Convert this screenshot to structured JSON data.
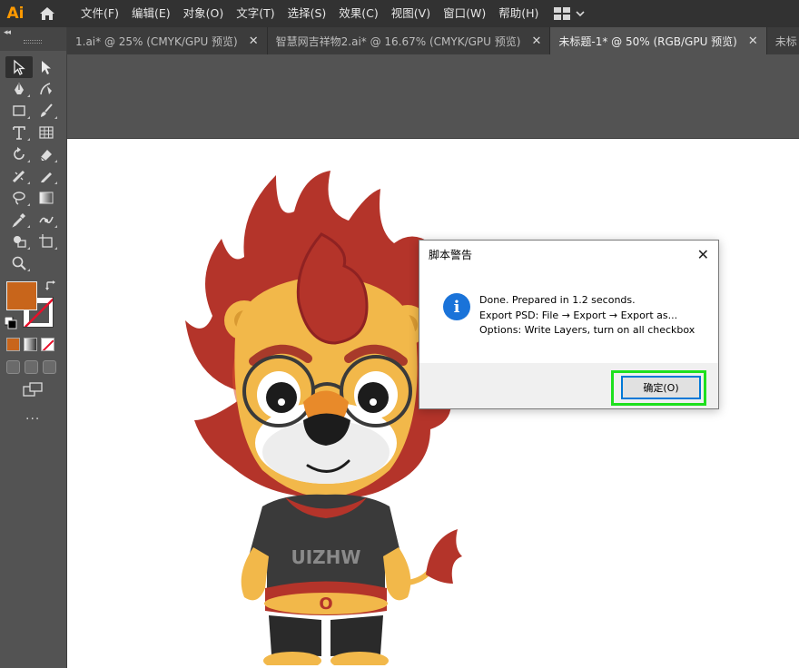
{
  "app": {
    "logo_text": "Ai",
    "accent_color": "#ff9a00"
  },
  "menubar": {
    "items": [
      "文件(F)",
      "编辑(E)",
      "对象(O)",
      "文字(T)",
      "选择(S)",
      "效果(C)",
      "视图(V)",
      "窗口(W)",
      "帮助(H)"
    ]
  },
  "tabs": [
    {
      "label": "1.ai* @ 25% (CMYK/GPU 预览)",
      "active": false
    },
    {
      "label": "智慧网吉祥物2.ai* @ 16.67% (CMYK/GPU 预览)",
      "active": false
    },
    {
      "label": "未标题-1* @ 50% (RGB/GPU 预览)",
      "active": true
    },
    {
      "label": "未标",
      "active": false
    }
  ],
  "toolbar": {
    "fill_color": "#c8651b",
    "stroke_color": "none",
    "more_label": "..."
  },
  "artwork": {
    "shirt_text": "UIZHW",
    "belt_text": "O"
  },
  "dialog": {
    "title": "脚本警告",
    "icon": "info-icon",
    "message_lines": [
      "Done. Prepared in 1.2 seconds.",
      "Export PSD: File → Export → Export as...",
      "Options: Write Layers, turn on all checkbox"
    ],
    "ok_label": "确定(O)",
    "highlight_color": "#1ee01e"
  }
}
